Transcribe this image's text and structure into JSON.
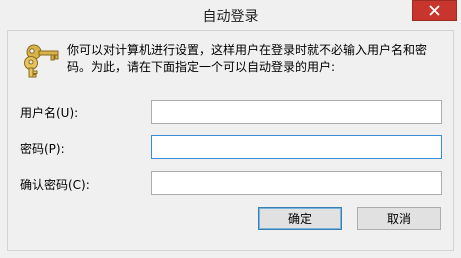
{
  "window": {
    "title": "自动登录",
    "close_icon": "close-icon",
    "close_color": "#c7352d"
  },
  "dialog": {
    "icon": "keys-icon",
    "message": "你可以对计算机进行设置，这样用户在登录时就不必输入用户名和密码。为此，请在下面指定一个可以自动登录的用户:"
  },
  "fields": {
    "username": {
      "label": "用户名(U):",
      "value": ""
    },
    "password": {
      "label": "密码(P):",
      "value": ""
    },
    "confirm_password": {
      "label": "确认密码(C):",
      "value": ""
    }
  },
  "buttons": {
    "ok_label": "确定",
    "cancel_label": "取消"
  },
  "colors": {
    "focus_border": "#3a8dd6",
    "key_gold": "#d8b24a"
  }
}
